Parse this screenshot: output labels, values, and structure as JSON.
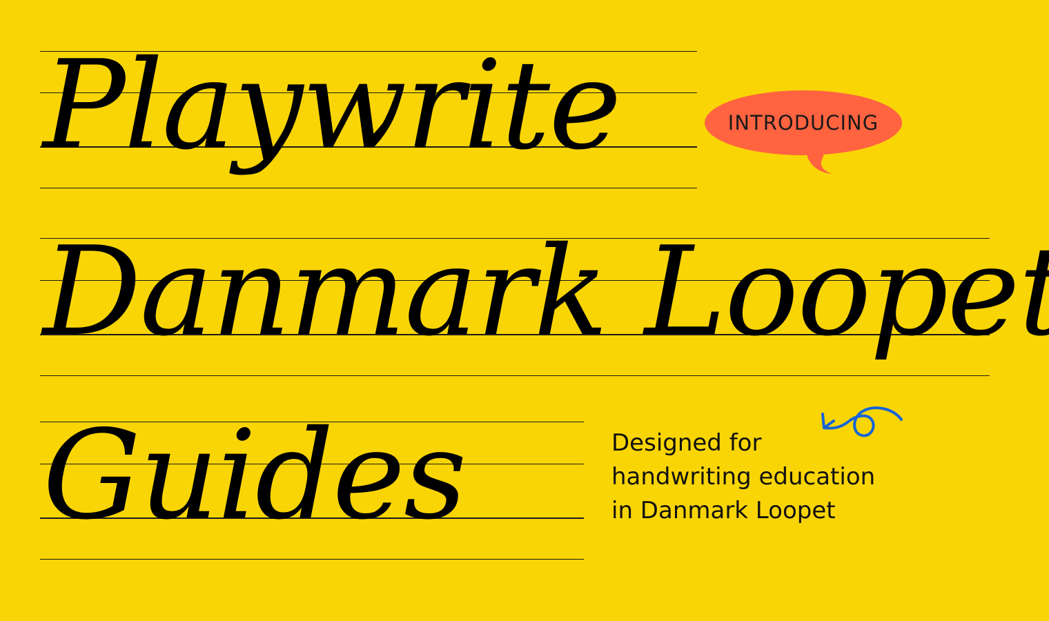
{
  "hero": {
    "line1": "Playwrite",
    "line2": "Danmark Loopet",
    "line3": "Guides"
  },
  "badge": {
    "label": "INTRODUCING",
    "color": "#FF6340"
  },
  "tagline": {
    "line1": "Designed for",
    "line2": "handwriting education",
    "line3": "in Danmark Loopet"
  },
  "theme": {
    "background": "#FAD505",
    "ink": "#000000",
    "accent_arrow": "#1565D8"
  },
  "icons": {
    "arrow": "curly-arrow-icon"
  }
}
